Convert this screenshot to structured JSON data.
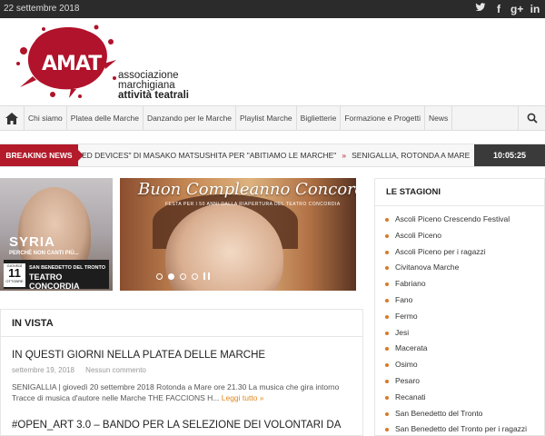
{
  "topbar": {
    "date": "22 settembre 2018",
    "social": [
      "twitter-icon",
      "facebook-icon",
      "google-plus-icon",
      "linkedin-icon"
    ]
  },
  "brand": {
    "logo_word": "AMAT",
    "line1": "associazione",
    "line2": "marchigiana",
    "line3": "attività teatrali",
    "color": "#b0132b"
  },
  "nav": {
    "items": [
      "Chi siamo",
      "Platea delle Marche",
      "Danzando per le Marche",
      "Playlist Marche",
      "Biglietterie",
      "Formazione e Progetti",
      "News"
    ]
  },
  "breaking": {
    "label": "BREAKING NEWS",
    "item1": "ED DEVICES\" DI MASAKO MATSUSHITA PER \"ABITIAMO LE MARCHE\"",
    "item2": "SENIGALLIA, ROTONDA A MARE GIOV",
    "time": "10:05:25"
  },
  "slider": {
    "left": {
      "title": "SYRIA",
      "subtitle": "PERCHÉ NON CANTI PIÙ...",
      "day_name": "GIOVEDÌ",
      "day": "11",
      "month": "OTTOBRE",
      "venue_city": "SAN BENEDETTO DEL TRONTO",
      "venue": "TEATRO CONCORDIA"
    },
    "main": {
      "title": "Buon Compleanno Concordia!",
      "subtitle": "FESTA PER I 50 ANNI DALLA RIAPERTURA DEL TEATRO CONCORDIA"
    }
  },
  "invista": {
    "heading": "IN VISTA",
    "article1": {
      "title": "IN QUESTI GIORNI NELLA PLATEA DELLE MARCHE",
      "date": "settembre 19, 2018",
      "comments": "Nessun commento",
      "excerpt": "SENIGALLIA | giovedì 20 settembre 2018 Rotonda a Mare ore 21.30 La musica che gira intorno Tracce di musica d'autore nelle Marche THE FACCIONS H...",
      "more": "Leggi tutto »"
    },
    "article2": {
      "title": "#OPEN_ART 3.0 – BANDO PER LA SELEZIONE DEI VOLONTARI DA"
    }
  },
  "sidebar": {
    "heading": "LE STAGIONI",
    "items": [
      "Ascoli Piceno Crescendo Festival",
      "Ascoli Piceno",
      "Ascoli Piceno per i ragazzi",
      "Civitanova Marche",
      "Fabriano",
      "Fano",
      "Fermo",
      "Jesi",
      "Macerata",
      "Osimo",
      "Pesaro",
      "Recanati",
      "San Benedetto del Tronto",
      "San Benedetto del Tronto per i ragazzi"
    ]
  }
}
